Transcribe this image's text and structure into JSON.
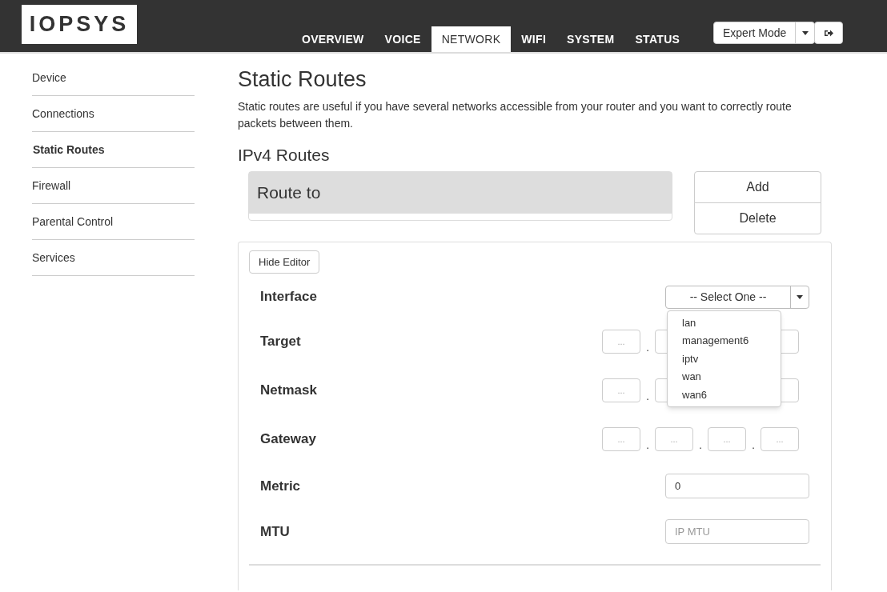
{
  "header": {
    "logo": "IOPSYS",
    "nav": [
      {
        "label": "OVERVIEW",
        "selected": false
      },
      {
        "label": "VOICE",
        "selected": false
      },
      {
        "label": "NETWORK",
        "selected": true
      },
      {
        "label": "WIFI",
        "selected": false
      },
      {
        "label": "SYSTEM",
        "selected": false
      },
      {
        "label": "STATUS",
        "selected": false
      }
    ],
    "mode": "Expert Mode"
  },
  "sidebar": {
    "items": [
      {
        "label": "Device",
        "selected": false
      },
      {
        "label": "Connections",
        "selected": false
      },
      {
        "label": "Static Routes",
        "selected": true
      },
      {
        "label": "Firewall",
        "selected": false
      },
      {
        "label": "Parental Control",
        "selected": false
      },
      {
        "label": "Services",
        "selected": false
      }
    ]
  },
  "title": "Static Routes",
  "description": "Static routes are useful if you have several networks accessible from your router and you want to correctly route packets between them.",
  "section": "IPv4 Routes",
  "routes_table": {
    "header": "Route to"
  },
  "actions": [
    "Add",
    "Delete"
  ],
  "editor": {
    "toggle": "Hide Editor",
    "rows": [
      {
        "kind": "select",
        "label": "Interface",
        "value": "-- Select One --",
        "options": [
          "lan",
          "management6",
          "iptv",
          "wan",
          "wan6"
        ]
      },
      {
        "kind": "ip",
        "label": "Target",
        "separators": [
          "."
        ],
        "placeholders": [
          "..."
        ]
      },
      {
        "kind": "ip",
        "label": "Netmask",
        "separators": [
          "."
        ],
        "placeholders": [
          "..."
        ]
      },
      {
        "kind": "ip",
        "label": "Gateway",
        "separators": [
          ".",
          ".",
          "."
        ],
        "placeholders": [
          "...",
          "...",
          "...",
          "..."
        ]
      },
      {
        "kind": "text",
        "label": "Metric",
        "value": "0"
      },
      {
        "kind": "text",
        "label": "MTU",
        "placeholder": "IP MTU"
      }
    ]
  }
}
